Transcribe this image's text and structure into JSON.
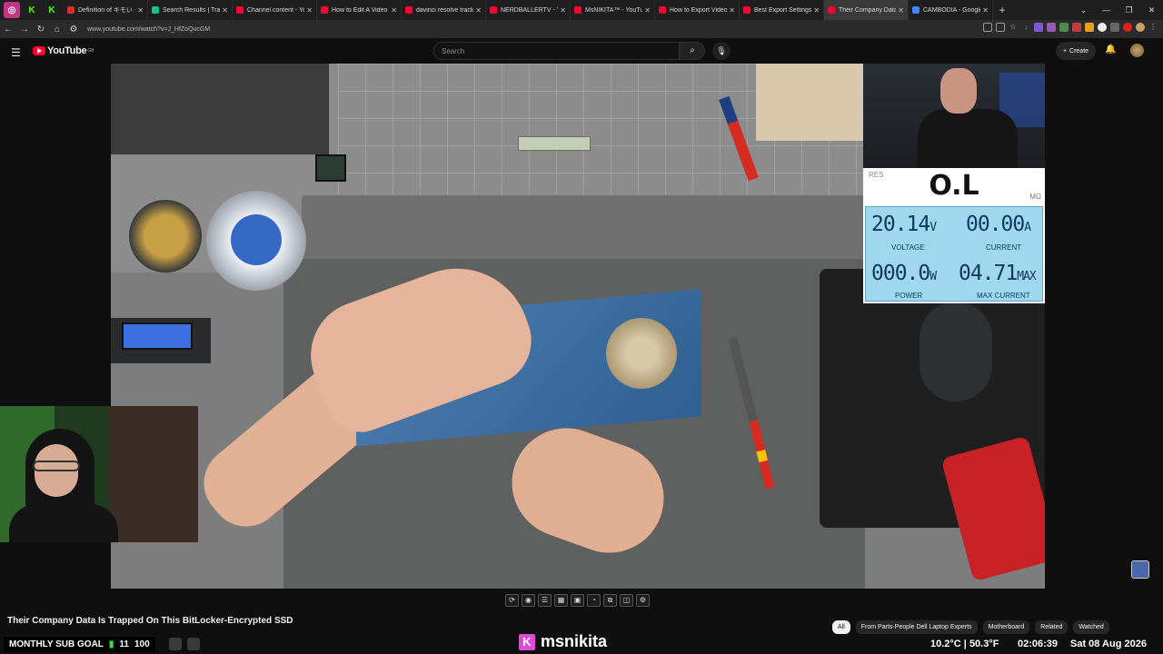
{
  "browser": {
    "tabs": [
      {
        "title": "Definition of キモい - Jap",
        "color": "#d93025"
      },
      {
        "title": "Search Results | Trainline",
        "color": "#19c38f"
      },
      {
        "title": "Channel content - YouTub",
        "color": "#ff0033"
      },
      {
        "title": "How to Edit A Video in Da",
        "color": "#ff0033"
      },
      {
        "title": "davinci resolve track, rem",
        "color": "#ff0033"
      },
      {
        "title": "NERDBALLERTV - YouTub",
        "color": "#ff0033"
      },
      {
        "title": "MsNIKITA™ - YouTube",
        "color": "#ff0033"
      },
      {
        "title": "How to Export Videos wit",
        "color": "#ff0033"
      },
      {
        "title": "Best Export Settings in Da",
        "color": "#ff0033"
      },
      {
        "title": "Their Company Data Is Tr",
        "color": "#ff0033",
        "active": true
      },
      {
        "title": "CAMBODIA - Google Sea",
        "color": "#4285f4"
      }
    ],
    "url": "www.youtube.com/watch?v=J_HfZoQucGM"
  },
  "youtube": {
    "logo": "YouTube",
    "region": "GB",
    "search_placeholder": "Search",
    "create_label": "Create"
  },
  "meter": {
    "res_label": "RES",
    "reading": "O.L",
    "reading_unit": "MΩ",
    "voltage": "20.14",
    "voltage_unit": "V",
    "voltage_label": "VOLTAGE",
    "current": "00.00",
    "current_unit": "A",
    "current_label": "CURRENT",
    "power": "000.0",
    "power_unit": "W",
    "power_label": "POWER",
    "max_current": "04.71",
    "max_current_unit": "MAX",
    "max_current_label": "MAX CURRENT"
  },
  "video": {
    "title": "Their Company Data Is Trapped On This BitLocker-Encrypted SSD"
  },
  "chips": [
    {
      "label": "All",
      "active": true
    },
    {
      "label": "From Parts-People Dell Laptop Experts"
    },
    {
      "label": "Motherboard"
    },
    {
      "label": "Related"
    },
    {
      "label": "Watched"
    }
  ],
  "overlay": {
    "goal_label": "MONTHLY SUB GOAL",
    "goal_current": "11",
    "goal_target": "100",
    "kick_letter": "K",
    "kick_name": "msnikita",
    "weather": "10.2°C | 50.3°F",
    "time": "02:06:39",
    "date": "Sat 08 Aug 2026"
  }
}
